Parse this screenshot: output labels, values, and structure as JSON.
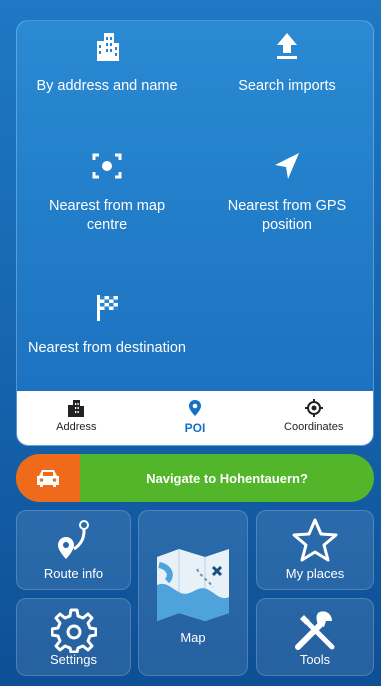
{
  "search_options": [
    {
      "label": "By address and name",
      "icon": "city-buildings-icon"
    },
    {
      "label": "Search imports",
      "icon": "upload-arrow-icon"
    },
    {
      "label": "Nearest from map centre",
      "icon": "map-centre-target-icon"
    },
    {
      "label": "Nearest from GPS position",
      "icon": "gps-navigation-arrow-icon"
    },
    {
      "label": "Nearest from destination",
      "icon": "checkered-flag-icon"
    }
  ],
  "tabs": [
    {
      "label": "Address",
      "icon": "city-buildings-icon",
      "active": false
    },
    {
      "label": "POI",
      "icon": "location-pin-icon",
      "active": true
    },
    {
      "label": "Coordinates",
      "icon": "crosshair-icon",
      "active": false
    }
  ],
  "nav_banner": {
    "text": "Navigate to Hohentauern?",
    "icon": "car-icon"
  },
  "menu_tiles": {
    "route_info": "Route info",
    "map": "Map",
    "my_places": "My places",
    "settings": "Settings",
    "tools": "Tools"
  },
  "colors": {
    "background": "#1563ad",
    "active_tab": "#1670c6",
    "navigate_green": "#52b52a",
    "navigate_orange": "#ef6a1a"
  }
}
